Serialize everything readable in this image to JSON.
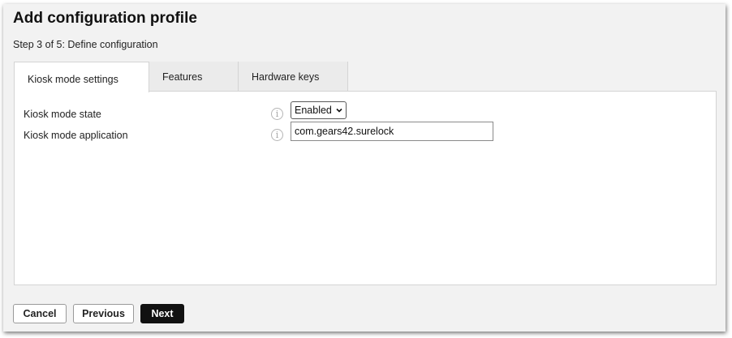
{
  "dialog": {
    "title": "Add configuration profile",
    "step": "Step 3 of 5: Define configuration"
  },
  "tabs": [
    {
      "label": "Kiosk mode settings",
      "active": true
    },
    {
      "label": "Features",
      "active": false
    },
    {
      "label": "Hardware keys",
      "active": false
    }
  ],
  "form": {
    "kiosk_mode_state": {
      "label": "Kiosk mode state",
      "info_icon": "info-icon",
      "value": "Enabled"
    },
    "kiosk_mode_application": {
      "label": "Kiosk mode application",
      "info_icon": "info-icon",
      "value": "com.gears42.surelock"
    }
  },
  "buttons": {
    "cancel": "Cancel",
    "previous": "Previous",
    "next": "Next"
  },
  "colors": {
    "primary_button": "#111111",
    "dialog_background": "#f2f2f2"
  }
}
